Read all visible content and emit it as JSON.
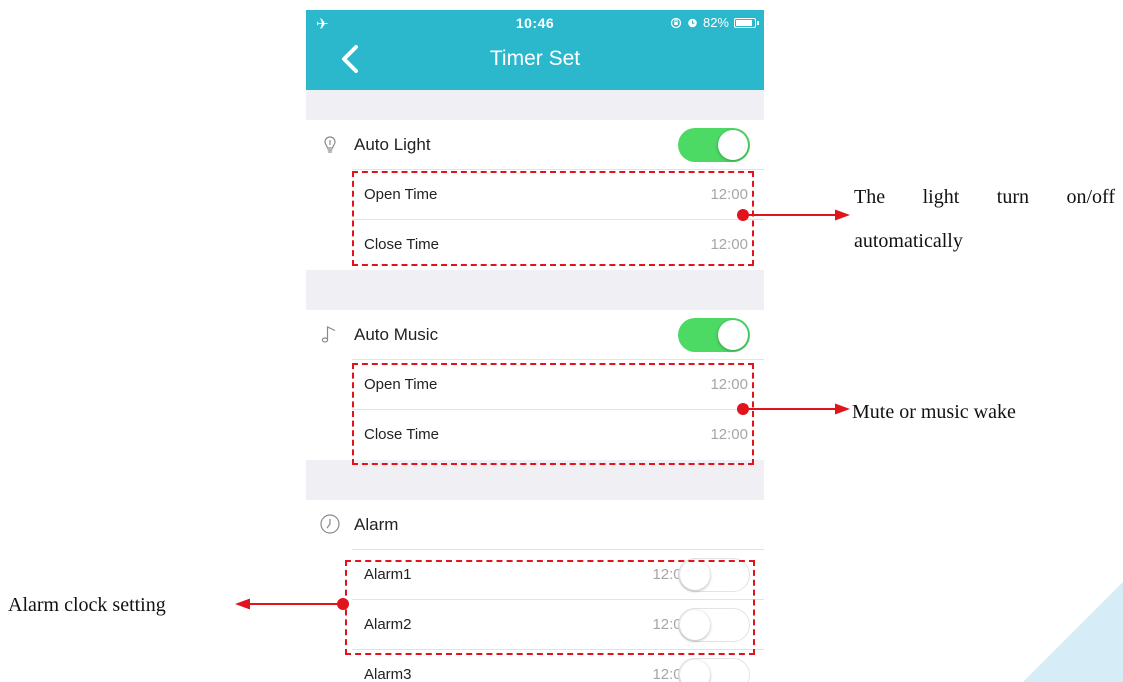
{
  "status_bar": {
    "airplane_glyph": "✈",
    "time": "10:46",
    "battery": "82%"
  },
  "nav": {
    "title": "Timer Set"
  },
  "auto_light": {
    "title": "Auto Light",
    "enabled": true,
    "rows": [
      {
        "label": "Open Time",
        "value": "12:00"
      },
      {
        "label": "Close Time",
        "value": "12:00"
      }
    ]
  },
  "auto_music": {
    "title": "Auto Music",
    "enabled": true,
    "rows": [
      {
        "label": "Open Time",
        "value": "12:00"
      },
      {
        "label": "Close Time",
        "value": "12:00"
      }
    ]
  },
  "alarm": {
    "title": "Alarm",
    "items": [
      {
        "label": "Alarm1",
        "time": "12:00",
        "enabled": false
      },
      {
        "label": "Alarm2",
        "time": "12:00",
        "enabled": false
      },
      {
        "label": "Alarm3",
        "time": "12:00",
        "enabled": false
      }
    ]
  },
  "annotations": {
    "light_line1": "The light turn on/off",
    "light_line2": "automatically",
    "music": "Mute or music wake",
    "alarm": "Alarm clock setting"
  },
  "colors": {
    "header": "#2bb7cc",
    "toggle_on": "#4cd964",
    "annotation_red": "#e0141a",
    "section_gap": "#efeff4",
    "corner_decoration": "#d6ecf6"
  }
}
